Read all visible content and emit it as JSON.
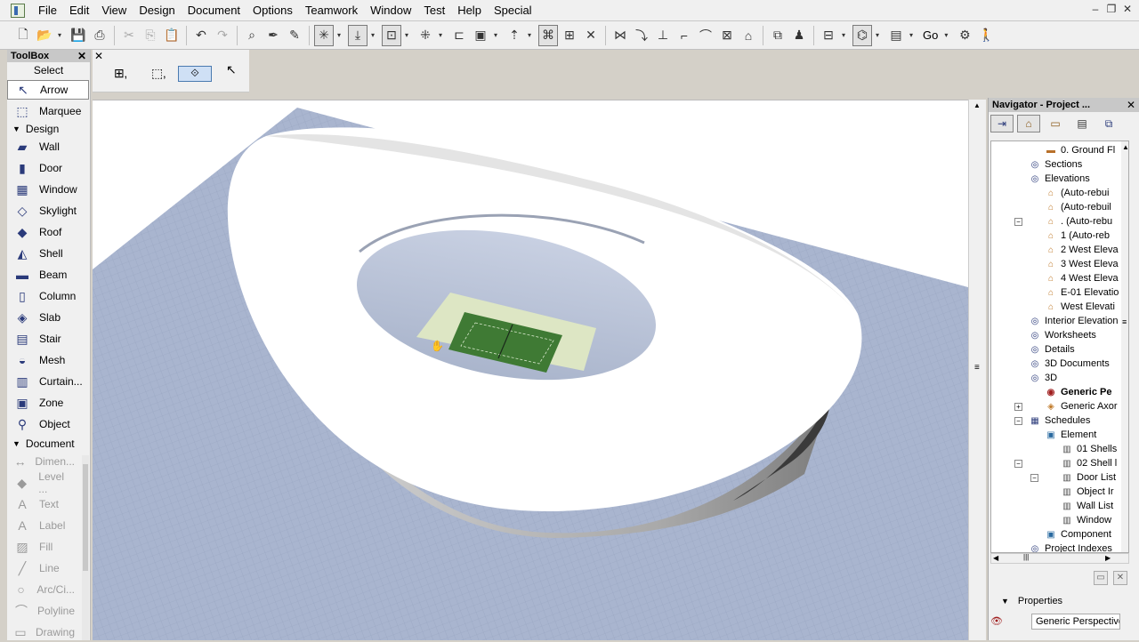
{
  "menu": [
    "File",
    "Edit",
    "View",
    "Design",
    "Document",
    "Options",
    "Teamwork",
    "Window",
    "Test",
    "Help",
    "Special"
  ],
  "toolbar": {
    "go_label": "Go"
  },
  "toolbox": {
    "title": "ToolBox",
    "select_label": "Select",
    "design_section": "Design",
    "document_section": "Document",
    "tools": [
      {
        "label": "Arrow",
        "icon": "arrow-icon",
        "glyph": "↖"
      },
      {
        "label": "Marquee",
        "icon": "marquee-icon",
        "glyph": "⬚"
      },
      {
        "label": "Wall",
        "icon": "wall-icon",
        "glyph": "▰"
      },
      {
        "label": "Door",
        "icon": "door-icon",
        "glyph": "▮"
      },
      {
        "label": "Window",
        "icon": "window-icon",
        "glyph": "▦"
      },
      {
        "label": "Skylight",
        "icon": "skylight-icon",
        "glyph": "◇"
      },
      {
        "label": "Roof",
        "icon": "roof-icon",
        "glyph": "◆"
      },
      {
        "label": "Shell",
        "icon": "shell-icon",
        "glyph": "◭"
      },
      {
        "label": "Beam",
        "icon": "beam-icon",
        "glyph": "▬"
      },
      {
        "label": "Column",
        "icon": "column-icon",
        "glyph": "▯"
      },
      {
        "label": "Slab",
        "icon": "slab-icon",
        "glyph": "◈"
      },
      {
        "label": "Stair",
        "icon": "stair-icon",
        "glyph": "▤"
      },
      {
        "label": "Mesh",
        "icon": "mesh-icon",
        "glyph": "◒"
      },
      {
        "label": "Curtain...",
        "icon": "curtain-wall-icon",
        "glyph": "▥"
      },
      {
        "label": "Zone",
        "icon": "zone-icon",
        "glyph": "▣"
      },
      {
        "label": "Object",
        "icon": "object-icon",
        "glyph": "⚲"
      }
    ],
    "doc_tools": [
      {
        "label": "Dimen...",
        "icon": "dimension-icon",
        "glyph": "↔"
      },
      {
        "label": "Level ...",
        "icon": "level-icon",
        "glyph": "◆"
      },
      {
        "label": "Text",
        "icon": "text-icon",
        "glyph": "A"
      },
      {
        "label": "Label",
        "icon": "label-icon",
        "glyph": "A"
      },
      {
        "label": "Fill",
        "icon": "fill-icon",
        "glyph": "▨"
      },
      {
        "label": "Line",
        "icon": "line-icon",
        "glyph": "╱"
      },
      {
        "label": "Arc/Ci...",
        "icon": "arc-icon",
        "glyph": "○"
      },
      {
        "label": "Polyline",
        "icon": "polyline-icon",
        "glyph": "⌒"
      },
      {
        "label": "Drawing",
        "icon": "drawing-icon",
        "glyph": "▭"
      }
    ]
  },
  "navigator": {
    "title": "Navigator - Project ...",
    "tree": [
      {
        "label": "0. Ground Fl",
        "indent": 60,
        "icon": "folder"
      },
      {
        "label": "Sections",
        "indent": 42,
        "icon": "view"
      },
      {
        "label": "Elevations",
        "indent": 42,
        "icon": "view"
      },
      {
        "label": "(Auto-rebui",
        "indent": 60,
        "icon": "house",
        "prefix": " "
      },
      {
        "label": "(Auto-rebuil",
        "indent": 60,
        "icon": "house"
      },
      {
        "label": ". (Auto-rebu",
        "indent": 60,
        "icon": "house"
      },
      {
        "label": "1   (Auto-reb",
        "indent": 60,
        "icon": "house"
      },
      {
        "label": "2 West Eleva",
        "indent": 60,
        "icon": "house"
      },
      {
        "label": "3 West Eleva",
        "indent": 60,
        "icon": "house"
      },
      {
        "label": "4 West Eleva",
        "indent": 60,
        "icon": "house"
      },
      {
        "label": "E-01 Elevatio",
        "indent": 60,
        "icon": "house"
      },
      {
        "label": "West Elevati",
        "indent": 60,
        "icon": "house"
      },
      {
        "label": "Interior Elevation",
        "indent": 42,
        "icon": "view"
      },
      {
        "label": "Worksheets",
        "indent": 42,
        "icon": "view"
      },
      {
        "label": "Details",
        "indent": 42,
        "icon": "view"
      },
      {
        "label": "3D Documents",
        "indent": 42,
        "icon": "view"
      },
      {
        "label": "3D",
        "indent": 42,
        "icon": "view"
      },
      {
        "label": "Generic Pe",
        "indent": 60,
        "icon": "eye",
        "bold": true
      },
      {
        "label": "Generic Axor",
        "indent": 60,
        "icon": "cube"
      },
      {
        "label": "Schedules",
        "indent": 42,
        "icon": "table"
      },
      {
        "label": "Element",
        "indent": 60,
        "icon": "schedule"
      },
      {
        "label": "01 Shells",
        "indent": 78,
        "icon": "list"
      },
      {
        "label": "02 Shell l",
        "indent": 78,
        "icon": "list"
      },
      {
        "label": "Door List",
        "indent": 78,
        "icon": "list"
      },
      {
        "label": "Object Ir",
        "indent": 78,
        "icon": "list"
      },
      {
        "label": "Wall List",
        "indent": 78,
        "icon": "list"
      },
      {
        "label": "Window",
        "indent": 78,
        "icon": "list"
      },
      {
        "label": "Component",
        "indent": 60,
        "icon": "schedule"
      },
      {
        "label": "Project Indexes",
        "indent": 42,
        "icon": "view"
      }
    ],
    "properties_label": "Properties",
    "properties_value": "Generic Perspective"
  },
  "colors": {
    "ground": "#a9b5cf",
    "building": "#ffffff",
    "court_surround": "#dde6c4",
    "court": "#3f7a34"
  }
}
